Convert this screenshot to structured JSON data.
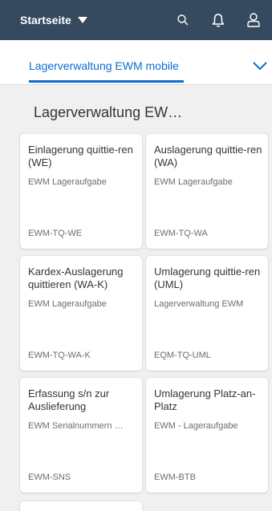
{
  "shell": {
    "title": "Startseite",
    "icons": [
      "search-icon",
      "bell-icon",
      "user-icon"
    ],
    "bg_color": "#354a5f"
  },
  "space": {
    "label": "Lagerverwaltung EWM mobile",
    "accent_color": "#0a6ed1"
  },
  "group": {
    "title": "Lagerverwaltung EW…"
  },
  "tiles": [
    {
      "title": "Einlagerung quittie-ren (WE)",
      "subtitle": "EWM Lageraufgabe",
      "footer": "EWM-TQ-WE"
    },
    {
      "title": "Auslagerung quittie-ren (WA)",
      "subtitle": "EWM Lageraufgabe",
      "footer": "EWM-TQ-WA"
    },
    {
      "title": "Kardex-Auslagerung quittieren (WA-K)",
      "subtitle": "EWM Lageraufgabe",
      "footer": "EWM-TQ-WA-K"
    },
    {
      "title": "Umlagerung quittie-ren (UML)",
      "subtitle": "Lagerverwaltung EWM",
      "footer": "EQM-TQ-UML"
    },
    {
      "title": "Erfassung s/n zur Auslieferung",
      "subtitle": "EWM Serialnummern …",
      "footer": "EWM-SNS"
    },
    {
      "title": "Umlagerung Platz-an-Platz",
      "subtitle": "EWM - Lageraufgabe",
      "footer": "EWM-BTB"
    }
  ]
}
